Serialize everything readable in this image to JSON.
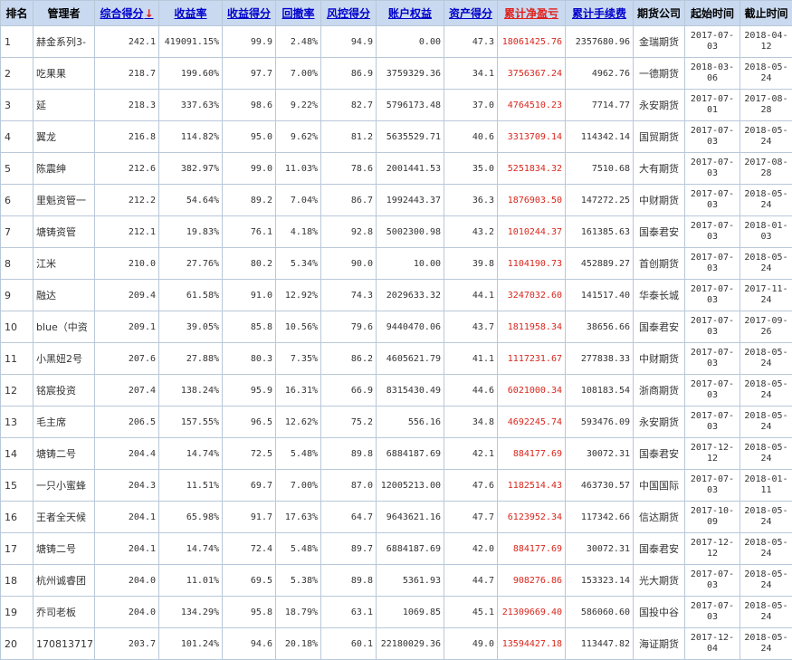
{
  "headers": {
    "rank": "排名",
    "manager": "管理者",
    "score": "综合得分",
    "return_rate": "收益率",
    "return_score": "收益得分",
    "drawdown": "回撤率",
    "risk_score": "风控得分",
    "equity": "账户权益",
    "asset_score": "资产得分",
    "net_pnl": "累计净盈亏",
    "fees": "累计手续费",
    "company": "期货公司",
    "start": "起始时间",
    "end": "截止时间"
  },
  "sort_indicator": "↓",
  "colors": {
    "header_bg": "#c9d9ef",
    "link": "#0000cc",
    "pnl": "#d9261c",
    "border": "#b9c8d9"
  },
  "rows": [
    {
      "rank": "1",
      "manager": "赫金系列3-",
      "score": "242.1",
      "return_rate": "419091.15%",
      "return_score": "99.9",
      "drawdown": "2.48%",
      "risk_score": "94.9",
      "equity": "0.00",
      "asset_score": "47.3",
      "net_pnl": "18061425.76",
      "fees": "2357680.96",
      "company": "金瑞期货",
      "start": "2017-07-03",
      "end": "2018-04-12"
    },
    {
      "rank": "2",
      "manager": "吃果果",
      "score": "218.7",
      "return_rate": "199.60%",
      "return_score": "97.7",
      "drawdown": "7.00%",
      "risk_score": "86.9",
      "equity": "3759329.36",
      "asset_score": "34.1",
      "net_pnl": "3756367.24",
      "fees": "4962.76",
      "company": "一德期货",
      "start": "2018-03-06",
      "end": "2018-05-24"
    },
    {
      "rank": "3",
      "manager": "延",
      "score": "218.3",
      "return_rate": "337.63%",
      "return_score": "98.6",
      "drawdown": "9.22%",
      "risk_score": "82.7",
      "equity": "5796173.48",
      "asset_score": "37.0",
      "net_pnl": "4764510.23",
      "fees": "7714.77",
      "company": "永安期货",
      "start": "2017-07-01",
      "end": "2017-08-28"
    },
    {
      "rank": "4",
      "manager": "翼龙",
      "score": "216.8",
      "return_rate": "114.82%",
      "return_score": "95.0",
      "drawdown": "9.62%",
      "risk_score": "81.2",
      "equity": "5635529.71",
      "asset_score": "40.6",
      "net_pnl": "3313709.14",
      "fees": "114342.14",
      "company": "国贸期货",
      "start": "2017-07-03",
      "end": "2018-05-24"
    },
    {
      "rank": "5",
      "manager": "陈震绅",
      "score": "212.6",
      "return_rate": "382.97%",
      "return_score": "99.0",
      "drawdown": "11.03%",
      "risk_score": "78.6",
      "equity": "2001441.53",
      "asset_score": "35.0",
      "net_pnl": "5251834.32",
      "fees": "7510.68",
      "company": "大有期货",
      "start": "2017-07-03",
      "end": "2017-08-28"
    },
    {
      "rank": "6",
      "manager": "里魁资管一",
      "score": "212.2",
      "return_rate": "54.64%",
      "return_score": "89.2",
      "drawdown": "7.04%",
      "risk_score": "86.7",
      "equity": "1992443.37",
      "asset_score": "36.3",
      "net_pnl": "1876903.50",
      "fees": "147272.25",
      "company": "中财期货",
      "start": "2017-07-03",
      "end": "2018-05-24"
    },
    {
      "rank": "7",
      "manager": "塘铸资管",
      "score": "212.1",
      "return_rate": "19.83%",
      "return_score": "76.1",
      "drawdown": "4.18%",
      "risk_score": "92.8",
      "equity": "5002300.98",
      "asset_score": "43.2",
      "net_pnl": "1010244.37",
      "fees": "161385.63",
      "company": "国泰君安",
      "start": "2017-07-03",
      "end": "2018-01-03"
    },
    {
      "rank": "8",
      "manager": "江米",
      "score": "210.0",
      "return_rate": "27.76%",
      "return_score": "80.2",
      "drawdown": "5.34%",
      "risk_score": "90.0",
      "equity": "10.00",
      "asset_score": "39.8",
      "net_pnl": "1104190.73",
      "fees": "452889.27",
      "company": "首创期货",
      "start": "2017-07-03",
      "end": "2018-05-24"
    },
    {
      "rank": "9",
      "manager": "融达",
      "score": "209.4",
      "return_rate": "61.58%",
      "return_score": "91.0",
      "drawdown": "12.92%",
      "risk_score": "74.3",
      "equity": "2029633.32",
      "asset_score": "44.1",
      "net_pnl": "3247032.60",
      "fees": "141517.40",
      "company": "华泰长城",
      "start": "2017-07-03",
      "end": "2017-11-24"
    },
    {
      "rank": "10",
      "manager": "blue（中资",
      "score": "209.1",
      "return_rate": "39.05%",
      "return_score": "85.8",
      "drawdown": "10.56%",
      "risk_score": "79.6",
      "equity": "9440470.06",
      "asset_score": "43.7",
      "net_pnl": "1811958.34",
      "fees": "38656.66",
      "company": "国泰君安",
      "start": "2017-07-03",
      "end": "2017-09-26"
    },
    {
      "rank": "11",
      "manager": "小黑妞2号",
      "score": "207.6",
      "return_rate": "27.88%",
      "return_score": "80.3",
      "drawdown": "7.35%",
      "risk_score": "86.2",
      "equity": "4605621.79",
      "asset_score": "41.1",
      "net_pnl": "1117231.67",
      "fees": "277838.33",
      "company": "中财期货",
      "start": "2017-07-03",
      "end": "2018-05-24"
    },
    {
      "rank": "12",
      "manager": "铭宸投资",
      "score": "207.4",
      "return_rate": "138.24%",
      "return_score": "95.9",
      "drawdown": "16.31%",
      "risk_score": "66.9",
      "equity": "8315430.49",
      "asset_score": "44.6",
      "net_pnl": "6021000.34",
      "fees": "108183.54",
      "company": "浙商期货",
      "start": "2017-07-03",
      "end": "2018-05-24"
    },
    {
      "rank": "13",
      "manager": "毛主席",
      "score": "206.5",
      "return_rate": "157.55%",
      "return_score": "96.5",
      "drawdown": "12.62%",
      "risk_score": "75.2",
      "equity": "556.16",
      "asset_score": "34.8",
      "net_pnl": "4692245.74",
      "fees": "593476.09",
      "company": "永安期货",
      "start": "2017-07-03",
      "end": "2018-05-24"
    },
    {
      "rank": "14",
      "manager": "塘铸二号",
      "score": "204.4",
      "return_rate": "14.74%",
      "return_score": "72.5",
      "drawdown": "5.48%",
      "risk_score": "89.8",
      "equity": "6884187.69",
      "asset_score": "42.1",
      "net_pnl": "884177.69",
      "fees": "30072.31",
      "company": "国泰君安",
      "start": "2017-12-12",
      "end": "2018-05-24"
    },
    {
      "rank": "15",
      "manager": "一只小蜜蜂",
      "score": "204.3",
      "return_rate": "11.51%",
      "return_score": "69.7",
      "drawdown": "7.00%",
      "risk_score": "87.0",
      "equity": "12005213.00",
      "asset_score": "47.6",
      "net_pnl": "1182514.43",
      "fees": "463730.57",
      "company": "中国国际",
      "start": "2017-07-03",
      "end": "2018-01-11"
    },
    {
      "rank": "16",
      "manager": "王者全天候",
      "score": "204.1",
      "return_rate": "65.98%",
      "return_score": "91.7",
      "drawdown": "17.63%",
      "risk_score": "64.7",
      "equity": "9643621.16",
      "asset_score": "47.7",
      "net_pnl": "6123952.34",
      "fees": "117342.66",
      "company": "信达期货",
      "start": "2017-10-09",
      "end": "2018-05-24"
    },
    {
      "rank": "17",
      "manager": "塘铸二号",
      "score": "204.1",
      "return_rate": "14.74%",
      "return_score": "72.4",
      "drawdown": "5.48%",
      "risk_score": "89.7",
      "equity": "6884187.69",
      "asset_score": "42.0",
      "net_pnl": "884177.69",
      "fees": "30072.31",
      "company": "国泰君安",
      "start": "2017-12-12",
      "end": "2018-05-24"
    },
    {
      "rank": "18",
      "manager": "杭州诚睿团",
      "score": "204.0",
      "return_rate": "11.01%",
      "return_score": "69.5",
      "drawdown": "5.38%",
      "risk_score": "89.8",
      "equity": "5361.93",
      "asset_score": "44.7",
      "net_pnl": "908276.86",
      "fees": "153323.14",
      "company": "光大期货",
      "start": "2017-07-03",
      "end": "2018-05-24"
    },
    {
      "rank": "19",
      "manager": "乔司老板",
      "score": "204.0",
      "return_rate": "134.29%",
      "return_score": "95.8",
      "drawdown": "18.79%",
      "risk_score": "63.1",
      "equity": "1069.85",
      "asset_score": "45.1",
      "net_pnl": "21309669.40",
      "fees": "586060.60",
      "company": "国投中谷",
      "start": "2017-07-03",
      "end": "2018-05-24"
    },
    {
      "rank": "20",
      "manager": "170813717:",
      "score": "203.7",
      "return_rate": "101.24%",
      "return_score": "94.6",
      "drawdown": "20.18%",
      "risk_score": "60.1",
      "equity": "22180029.36",
      "asset_score": "49.0",
      "net_pnl": "13594427.18",
      "fees": "113447.82",
      "company": "海证期货",
      "start": "2017-12-04",
      "end": "2018-05-24"
    }
  ]
}
